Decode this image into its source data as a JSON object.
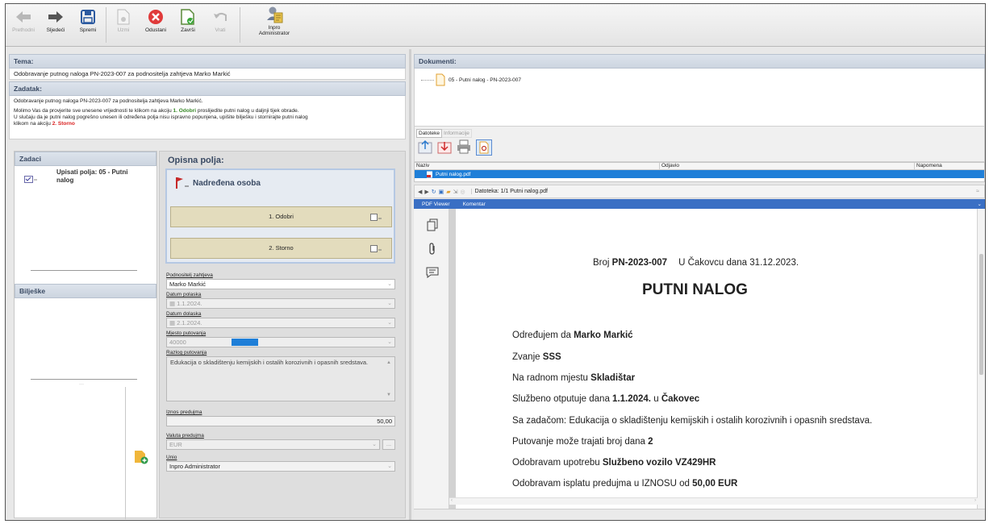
{
  "toolbar": {
    "buttons": [
      {
        "label": "Prethodni",
        "icon": "arrow-left-icon",
        "enabled": false
      },
      {
        "label": "Sljedeći",
        "icon": "arrow-right-icon",
        "enabled": true
      },
      {
        "label": "Spremi",
        "icon": "save-icon",
        "enabled": true
      },
      {
        "label": "Uzmi",
        "icon": "take-document-icon",
        "enabled": false
      },
      {
        "label": "Odustani",
        "icon": "cancel-icon",
        "enabled": true
      },
      {
        "label": "Završi",
        "icon": "finish-icon",
        "enabled": true
      },
      {
        "label": "Vrati",
        "icon": "undo-icon",
        "enabled": false
      }
    ],
    "user_line1": "Inpro",
    "user_line2": "Administrator"
  },
  "tema": {
    "header": "Tema:",
    "text": "Odobravanje putnog naloga PN-2023-007 za podnositelja zahtjeva Marko Markić"
  },
  "zadatak": {
    "header": "Zadatak:",
    "line1": "Odobravanje putnog naloga PN-2023-007 za podnositelja zahtjeva Marko Markić.",
    "line2_a": "Molimo Vas da provjerite sve unesene vrijednosti te klikom na akciju ",
    "line2_b": "1. Odobri",
    "line2_c": " proslijedite putni nalog u daljnji tijek obrade.",
    "line3": "U slučaju da je putni nalog pogrešno unesen ili određena polja nisu ispravno popunjena, upišite bilješku i stornirajte putni nalog",
    "line4_a": "klikom na akciju ",
    "line4_b": "2. Storno"
  },
  "zadaci": {
    "header": "Zadaci",
    "item": "Upisati polja: 05 - Putni nalog"
  },
  "biljeske": {
    "header": "Bilješke"
  },
  "opisna": {
    "header": "Opisna polja:",
    "group_title": "Nadređena osoba",
    "btn1": "1. Odobri",
    "btn2": "2. Storno",
    "fields": {
      "podnositelj_label": "Podnositelj zahtjeva",
      "podnositelj_value": "Marko Markić",
      "datum_polaska_label": "Datum polaska",
      "datum_polaska_value": "1.1.2024.",
      "datum_dolaska_label": "Datum dolaska",
      "datum_dolaska_value": "2.1.2024.",
      "mjesto_label": "Mjesto putovanja",
      "mjesto_code": "40000",
      "mjesto_name": "Čakovec",
      "razlog_label": "Razlog putovanja",
      "razlog_value": "Edukacija o skladištenju kemijskih i ostalih korozivnih i opasnih sredstava.",
      "iznos_label": "Iznos predujma",
      "iznos_value": "50,00",
      "valuta_label": "Valuta predujma",
      "valuta_value": "EUR",
      "valuta_btn": "...",
      "unio_label": "Unio",
      "unio_value": "Inpro Administrator"
    }
  },
  "dokumenti": {
    "header": "Dokumenti:",
    "tree_item": "05 - Putni nalog - PN-2023-007",
    "tabs": [
      "Datoteke",
      "Informacije"
    ],
    "columns": [
      "Naziv",
      "Odjavio",
      "Napomena"
    ],
    "file_row": "Putni nalog.pdf"
  },
  "pdf": {
    "nav_text": "Datoteka: 1/1  Putni nalog.pdf",
    "tabs": [
      "PDF Viewer",
      "Komentar"
    ],
    "broj_label": "Broj ",
    "broj_value": "PN-2023-007",
    "mjesto_datum": "U Čakovcu dana 31.12.2023.",
    "title": "PUTNI NALOG",
    "l1_a": "Određujem da ",
    "l1_b": "Marko Markić",
    "l2_a": "Zvanje ",
    "l2_b": "SSS",
    "l3_a": "Na radnom mjestu ",
    "l3_b": "Skladištar",
    "l4_a": "Službeno otputuje dana ",
    "l4_b": "1.1.2024.",
    "l4_c": " u ",
    "l4_d": "Čakovec",
    "l5": "Sa zadačom: Edukacija o skladištenju kemijskih i ostalih korozivnih i opasnih sredstava.",
    "l6_a": "Putovanje može trajati broj dana ",
    "l6_b": "2",
    "l7_a": "Odobravam upotrebu ",
    "l7_b": "Službeno vozilo VZ429HR",
    "l8_a": "Odobravam isplatu predujma u IZNOSU od ",
    "l8_b": "50,00 EUR"
  },
  "colors": {
    "accent": "#3a6fc4",
    "selection": "#1f7fd8",
    "danger": "#d92020",
    "header_text": "#3a4a63"
  }
}
